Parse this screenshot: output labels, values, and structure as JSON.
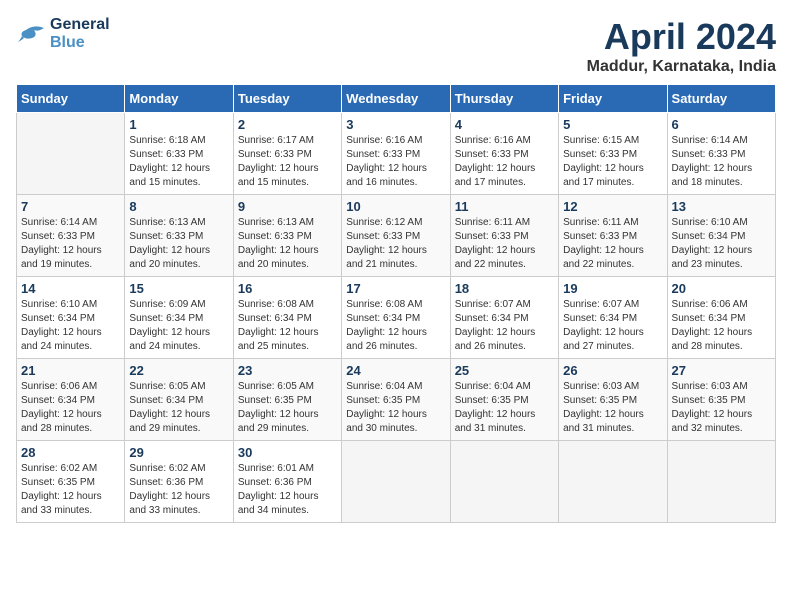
{
  "header": {
    "logo_line1": "General",
    "logo_line2": "Blue",
    "month_title": "April 2024",
    "location": "Maddur, Karnataka, India"
  },
  "weekdays": [
    "Sunday",
    "Monday",
    "Tuesday",
    "Wednesday",
    "Thursday",
    "Friday",
    "Saturday"
  ],
  "weeks": [
    [
      {
        "day": "",
        "info": ""
      },
      {
        "day": "1",
        "info": "Sunrise: 6:18 AM\nSunset: 6:33 PM\nDaylight: 12 hours\nand 15 minutes."
      },
      {
        "day": "2",
        "info": "Sunrise: 6:17 AM\nSunset: 6:33 PM\nDaylight: 12 hours\nand 15 minutes."
      },
      {
        "day": "3",
        "info": "Sunrise: 6:16 AM\nSunset: 6:33 PM\nDaylight: 12 hours\nand 16 minutes."
      },
      {
        "day": "4",
        "info": "Sunrise: 6:16 AM\nSunset: 6:33 PM\nDaylight: 12 hours\nand 17 minutes."
      },
      {
        "day": "5",
        "info": "Sunrise: 6:15 AM\nSunset: 6:33 PM\nDaylight: 12 hours\nand 17 minutes."
      },
      {
        "day": "6",
        "info": "Sunrise: 6:14 AM\nSunset: 6:33 PM\nDaylight: 12 hours\nand 18 minutes."
      }
    ],
    [
      {
        "day": "7",
        "info": "Sunrise: 6:14 AM\nSunset: 6:33 PM\nDaylight: 12 hours\nand 19 minutes."
      },
      {
        "day": "8",
        "info": "Sunrise: 6:13 AM\nSunset: 6:33 PM\nDaylight: 12 hours\nand 20 minutes."
      },
      {
        "day": "9",
        "info": "Sunrise: 6:13 AM\nSunset: 6:33 PM\nDaylight: 12 hours\nand 20 minutes."
      },
      {
        "day": "10",
        "info": "Sunrise: 6:12 AM\nSunset: 6:33 PM\nDaylight: 12 hours\nand 21 minutes."
      },
      {
        "day": "11",
        "info": "Sunrise: 6:11 AM\nSunset: 6:33 PM\nDaylight: 12 hours\nand 22 minutes."
      },
      {
        "day": "12",
        "info": "Sunrise: 6:11 AM\nSunset: 6:33 PM\nDaylight: 12 hours\nand 22 minutes."
      },
      {
        "day": "13",
        "info": "Sunrise: 6:10 AM\nSunset: 6:34 PM\nDaylight: 12 hours\nand 23 minutes."
      }
    ],
    [
      {
        "day": "14",
        "info": "Sunrise: 6:10 AM\nSunset: 6:34 PM\nDaylight: 12 hours\nand 24 minutes."
      },
      {
        "day": "15",
        "info": "Sunrise: 6:09 AM\nSunset: 6:34 PM\nDaylight: 12 hours\nand 24 minutes."
      },
      {
        "day": "16",
        "info": "Sunrise: 6:08 AM\nSunset: 6:34 PM\nDaylight: 12 hours\nand 25 minutes."
      },
      {
        "day": "17",
        "info": "Sunrise: 6:08 AM\nSunset: 6:34 PM\nDaylight: 12 hours\nand 26 minutes."
      },
      {
        "day": "18",
        "info": "Sunrise: 6:07 AM\nSunset: 6:34 PM\nDaylight: 12 hours\nand 26 minutes."
      },
      {
        "day": "19",
        "info": "Sunrise: 6:07 AM\nSunset: 6:34 PM\nDaylight: 12 hours\nand 27 minutes."
      },
      {
        "day": "20",
        "info": "Sunrise: 6:06 AM\nSunset: 6:34 PM\nDaylight: 12 hours\nand 28 minutes."
      }
    ],
    [
      {
        "day": "21",
        "info": "Sunrise: 6:06 AM\nSunset: 6:34 PM\nDaylight: 12 hours\nand 28 minutes."
      },
      {
        "day": "22",
        "info": "Sunrise: 6:05 AM\nSunset: 6:34 PM\nDaylight: 12 hours\nand 29 minutes."
      },
      {
        "day": "23",
        "info": "Sunrise: 6:05 AM\nSunset: 6:35 PM\nDaylight: 12 hours\nand 29 minutes."
      },
      {
        "day": "24",
        "info": "Sunrise: 6:04 AM\nSunset: 6:35 PM\nDaylight: 12 hours\nand 30 minutes."
      },
      {
        "day": "25",
        "info": "Sunrise: 6:04 AM\nSunset: 6:35 PM\nDaylight: 12 hours\nand 31 minutes."
      },
      {
        "day": "26",
        "info": "Sunrise: 6:03 AM\nSunset: 6:35 PM\nDaylight: 12 hours\nand 31 minutes."
      },
      {
        "day": "27",
        "info": "Sunrise: 6:03 AM\nSunset: 6:35 PM\nDaylight: 12 hours\nand 32 minutes."
      }
    ],
    [
      {
        "day": "28",
        "info": "Sunrise: 6:02 AM\nSunset: 6:35 PM\nDaylight: 12 hours\nand 33 minutes."
      },
      {
        "day": "29",
        "info": "Sunrise: 6:02 AM\nSunset: 6:36 PM\nDaylight: 12 hours\nand 33 minutes."
      },
      {
        "day": "30",
        "info": "Sunrise: 6:01 AM\nSunset: 6:36 PM\nDaylight: 12 hours\nand 34 minutes."
      },
      {
        "day": "",
        "info": ""
      },
      {
        "day": "",
        "info": ""
      },
      {
        "day": "",
        "info": ""
      },
      {
        "day": "",
        "info": ""
      }
    ]
  ]
}
